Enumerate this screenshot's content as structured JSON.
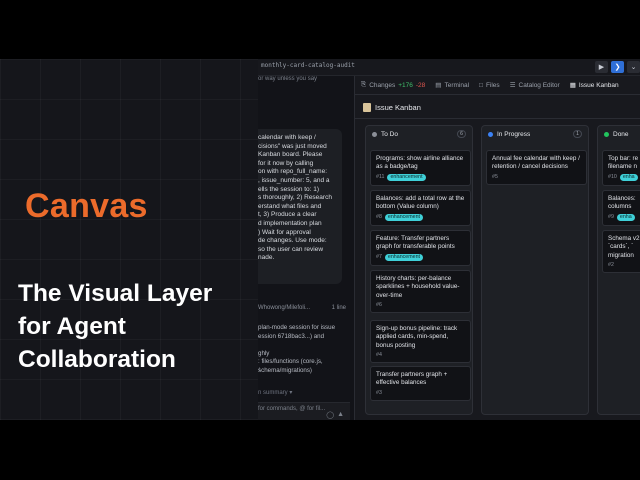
{
  "hero": {
    "title": "Canvas",
    "subtitle_lines": [
      "The Visual Layer",
      "for Agent",
      "Collaboration"
    ]
  },
  "toolbar": {
    "repo": "monthly-card-catalog-audit",
    "icons": [
      "play-icon",
      "vscode-icon",
      "chevron-down-icon"
    ]
  },
  "chat": {
    "cut_line": "or way unless you say",
    "bubble_text": "calendar with keep /\ncisions\" was just moved\nKanban board. Please\nfor it now by calling\non with repo_full_name:\n, issue_number: 5, and a\nells the session to: 1)\ns thoroughly, 2) Research\nerstand what files and\nt, 3) Produce a clear\nd implementation plan\n) Wait for approval\nde changes. Use mode:\nso the user can review\nnade.",
    "meta_left": "Whowong/Milefoli...",
    "meta_right": "1 line",
    "body_text": "plan-mode session for issue\nession 6718bac3...) and\n\nghly\n: files/functions (core.js,\nschema/migrations)",
    "more": "n summary ▾",
    "input_placeholder": "for commands, @ for fil..."
  },
  "tabs": [
    {
      "label": "Changes",
      "added": "+176",
      "removed": "-28",
      "icon": "changes-icon",
      "active": false
    },
    {
      "label": "Terminal",
      "icon": "terminal-icon",
      "active": false
    },
    {
      "label": "Files",
      "icon": "files-icon",
      "active": false
    },
    {
      "label": "Catalog Editor",
      "icon": "catalog-icon",
      "active": false
    },
    {
      "label": "Issue Kanban",
      "icon": "kanban-icon",
      "active": true
    }
  ],
  "kanban": {
    "title": "Issue Kanban",
    "columns": [
      {
        "name": "To Do",
        "count": "6",
        "color": "#8b8f98",
        "cards": [
          {
            "title": "Programs: show airline alliance\nas a badge/tag",
            "number": "#11",
            "tag": "enhancement"
          },
          {
            "title": "Balances: add a total row at the\nbottom (Value column)",
            "number": "#8",
            "tag": "enhancement"
          },
          {
            "title": "Feature: Transfer partners\ngraph for transferable points",
            "number": "#7",
            "tag": "enhancement"
          },
          {
            "title": "History charts: per-balance\nsparklines + household value-\nover-time",
            "number": "#6",
            "tag": ""
          },
          {
            "title": "Sign-up bonus pipeline: track\napplied cards, min-spend,\nbonus posting",
            "number": "#4",
            "tag": ""
          },
          {
            "title": "Transfer partners graph +\neffective balances",
            "number": "#3",
            "tag": ""
          }
        ]
      },
      {
        "name": "In Progress",
        "count": "1",
        "color": "#3b82f6",
        "cards": [
          {
            "title": "Annual fee calendar with keep /\nretention / cancel decisions",
            "number": "#5",
            "tag": ""
          }
        ]
      },
      {
        "name": "Done",
        "count": "",
        "color": "#22c55e",
        "cards": [
          {
            "title": "Top bar: re\nfilename n",
            "number": "#10",
            "tag": "enha"
          },
          {
            "title": "Balances:\ncolumns",
            "number": "#9",
            "tag": "enha"
          },
          {
            "title": "Schema v2\n`cards`, `\nmigration",
            "number": "#2",
            "tag": ""
          }
        ]
      }
    ]
  }
}
